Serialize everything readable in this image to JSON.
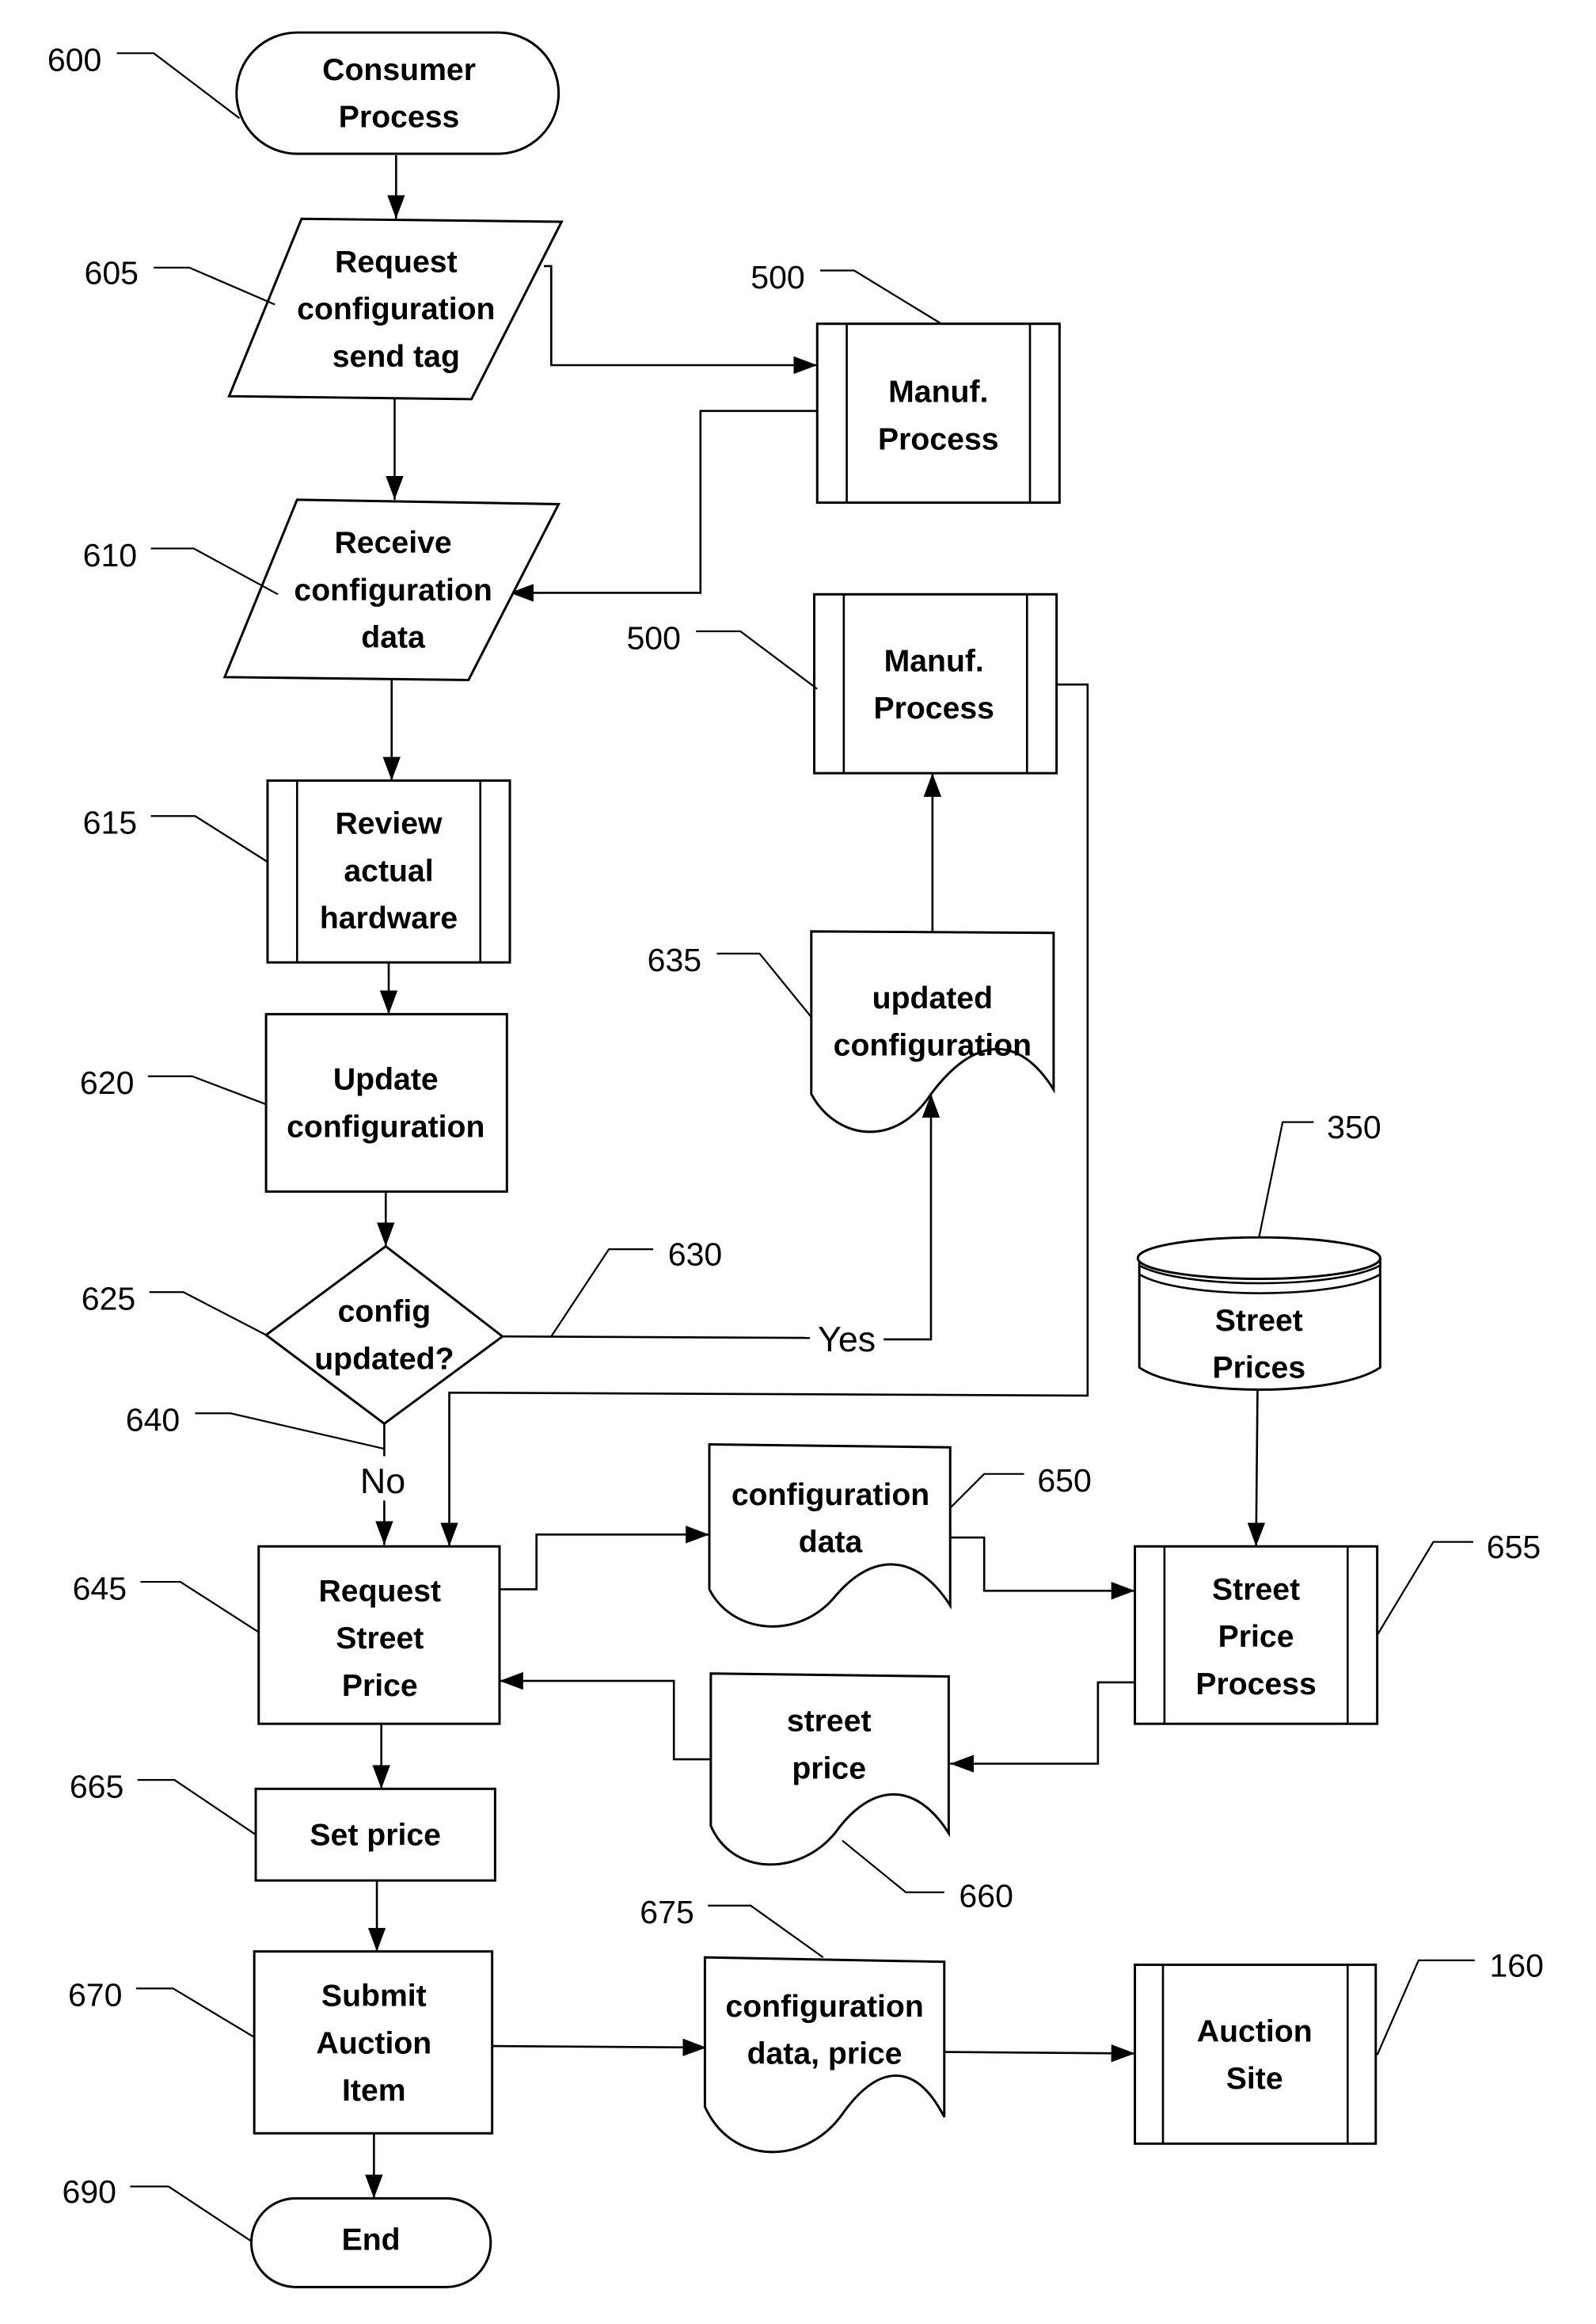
{
  "diagram": {
    "type": "flowchart",
    "nodes": [
      {
        "id": "600",
        "ref": "600",
        "shape": "terminator",
        "lines": [
          "Consumer",
          "Process"
        ]
      },
      {
        "id": "605",
        "ref": "605",
        "shape": "data",
        "lines": [
          "Request",
          "configuration",
          "send tag"
        ]
      },
      {
        "id": "500a",
        "ref": "500",
        "shape": "predefined-process",
        "lines": [
          "Manuf.",
          "Process"
        ]
      },
      {
        "id": "610",
        "ref": "610",
        "shape": "data",
        "lines": [
          "Receive",
          "configuration",
          "data"
        ]
      },
      {
        "id": "500b",
        "ref": "500",
        "shape": "predefined-process",
        "lines": [
          "Manuf.",
          "Process"
        ]
      },
      {
        "id": "615",
        "ref": "615",
        "shape": "predefined-process",
        "lines": [
          "Review",
          "actual",
          "hardware"
        ]
      },
      {
        "id": "620",
        "ref": "620",
        "shape": "process",
        "lines": [
          "Update",
          "configuration"
        ]
      },
      {
        "id": "635",
        "ref": "635",
        "shape": "document",
        "lines": [
          "updated",
          "configuration"
        ]
      },
      {
        "id": "625",
        "ref": "625",
        "shape": "decision",
        "lines": [
          "config",
          "updated?"
        ]
      },
      {
        "id": "350",
        "ref": "350",
        "shape": "database",
        "lines": [
          "Street",
          "Prices"
        ]
      },
      {
        "id": "645",
        "ref": "645",
        "shape": "process",
        "lines": [
          "Request",
          "Street",
          "Price"
        ]
      },
      {
        "id": "650",
        "ref": "650",
        "shape": "document",
        "lines": [
          "configuration",
          "data"
        ]
      },
      {
        "id": "655",
        "ref": "655",
        "shape": "predefined-process",
        "lines": [
          "Street",
          "Price",
          "Process"
        ]
      },
      {
        "id": "660",
        "ref": "660",
        "shape": "document",
        "lines": [
          "street",
          "price"
        ]
      },
      {
        "id": "665",
        "ref": "665",
        "shape": "process",
        "lines": [
          "Set price"
        ]
      },
      {
        "id": "670",
        "ref": "670",
        "shape": "process",
        "lines": [
          "Submit",
          "Auction",
          "Item"
        ]
      },
      {
        "id": "675",
        "ref": "675",
        "shape": "document",
        "lines": [
          "configuration",
          "data, price"
        ]
      },
      {
        "id": "160",
        "ref": "160",
        "shape": "predefined-process",
        "lines": [
          "Auction",
          "Site"
        ]
      },
      {
        "id": "690",
        "ref": "690",
        "shape": "terminator",
        "lines": [
          "End"
        ]
      }
    ],
    "edges": [
      {
        "from": "600",
        "to": "605"
      },
      {
        "from": "605",
        "to": "500a"
      },
      {
        "from": "605",
        "to": "610"
      },
      {
        "from": "500a",
        "to": "610"
      },
      {
        "from": "610",
        "to": "615"
      },
      {
        "from": "615",
        "to": "620"
      },
      {
        "from": "620",
        "to": "625"
      },
      {
        "from": "625",
        "to": "635",
        "label": "Yes",
        "ref": "630"
      },
      {
        "from": "635",
        "to": "500b"
      },
      {
        "from": "500b",
        "to": "645"
      },
      {
        "from": "625",
        "to": "645",
        "label": "No",
        "ref": "640"
      },
      {
        "from": "645",
        "to": "650"
      },
      {
        "from": "650",
        "to": "655"
      },
      {
        "from": "350",
        "to": "655"
      },
      {
        "from": "655",
        "to": "660"
      },
      {
        "from": "660",
        "to": "645"
      },
      {
        "from": "645",
        "to": "665"
      },
      {
        "from": "665",
        "to": "670"
      },
      {
        "from": "670",
        "to": "675"
      },
      {
        "from": "675",
        "to": "160"
      },
      {
        "from": "670",
        "to": "690"
      }
    ],
    "edge_labels": {
      "yes": "Yes",
      "no": "No"
    },
    "edge_refs": {
      "yes": "630",
      "no": "640"
    }
  }
}
